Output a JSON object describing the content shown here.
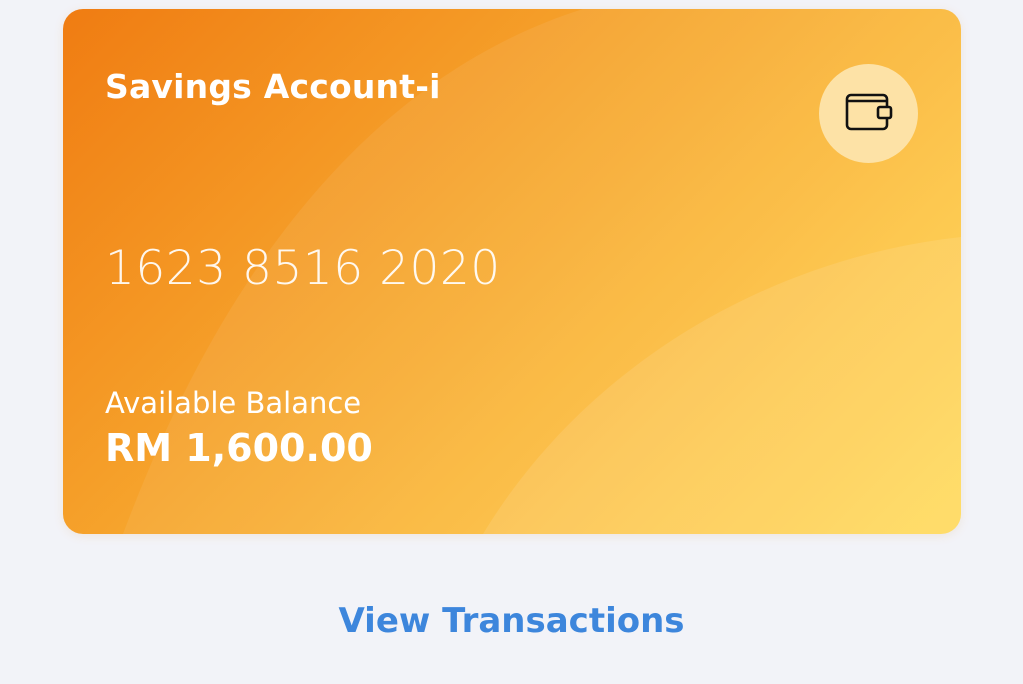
{
  "account_card": {
    "title": "Savings Account-i",
    "account_number": "1623 8516 2020",
    "balance_label": "Available Balance",
    "balance_value": "RM 1,600.00",
    "icon": "wallet-icon",
    "gradient_colors": [
      "#f07c12",
      "#f6a52d",
      "#fdc443",
      "#ffd84f"
    ],
    "icon_background": "#fde2a6"
  },
  "actions": {
    "view_transactions_label": "View Transactions",
    "link_color": "#3d86dc"
  },
  "theme": {
    "page_background": "#f2f3f8"
  }
}
